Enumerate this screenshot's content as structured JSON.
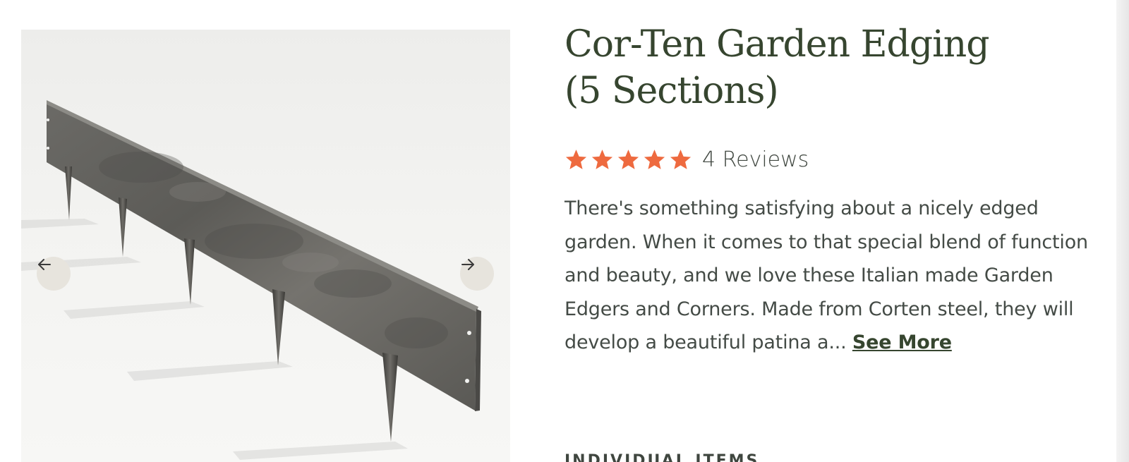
{
  "product": {
    "title": "Cor-Ten Garden Edging (5 Sections)",
    "rating": {
      "stars": 5,
      "max_stars": 5,
      "review_label": "4 Reviews"
    },
    "description": "There's something satisfying about a nicely edged garden. When it comes to that special blend of function and beauty, and we love these Italian made Garden Edgers and Corners. Made from Corten steel, they will develop a beautiful patina a...",
    "see_more_label": "See More",
    "section_heading": "INDIVIDUAL ITEMS"
  },
  "gallery": {
    "prev_icon": "arrow-left-icon",
    "next_icon": "arrow-right-icon"
  },
  "colors": {
    "title": "#36452f",
    "star": "#ee6a3f",
    "text": "#444b46",
    "nav_button_bg": "#e7e4dd"
  }
}
